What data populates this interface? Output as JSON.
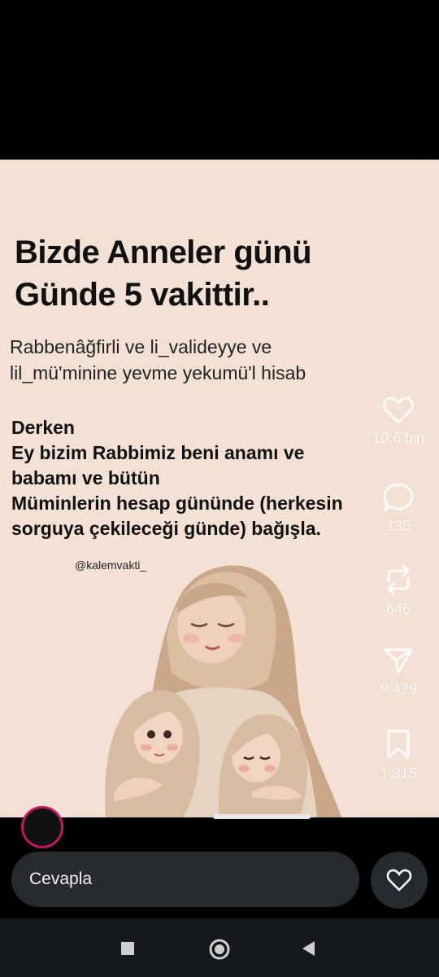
{
  "post": {
    "title_lines": [
      "Bizde Anneler günü",
      "Günde 5 vakittir.."
    ],
    "prayer_lines": [
      "Rabbenâğfirli ve li_valideyye ve",
      "lil_mü'minine yevme yekumü'l hisab"
    ],
    "meaning_lines": [
      "Derken",
      "Ey bizim Rabbimiz beni anamı ve",
      "babamı ve bütün",
      "Müminlerin hesap gününde (herkesin",
      "sorguya çekileceği günde)  bağışla."
    ],
    "handle": "@kalemvakti_",
    "background_color": "#f4e1d6"
  },
  "actions": {
    "likes": "10,6 bin",
    "comments": "135",
    "reposts": "646",
    "shares": "9.429",
    "saves": "1.315"
  },
  "reply": {
    "placeholder": "Cevapla"
  },
  "icons": {
    "like": "heart-icon",
    "comment": "comment-bubble-icon",
    "repost": "repost-arrows-icon",
    "share": "paper-plane-icon",
    "save": "bookmark-icon",
    "reply_like": "heart-outline-icon",
    "nav": [
      "square-recents-icon",
      "circle-home-icon",
      "triangle-back-icon"
    ]
  }
}
